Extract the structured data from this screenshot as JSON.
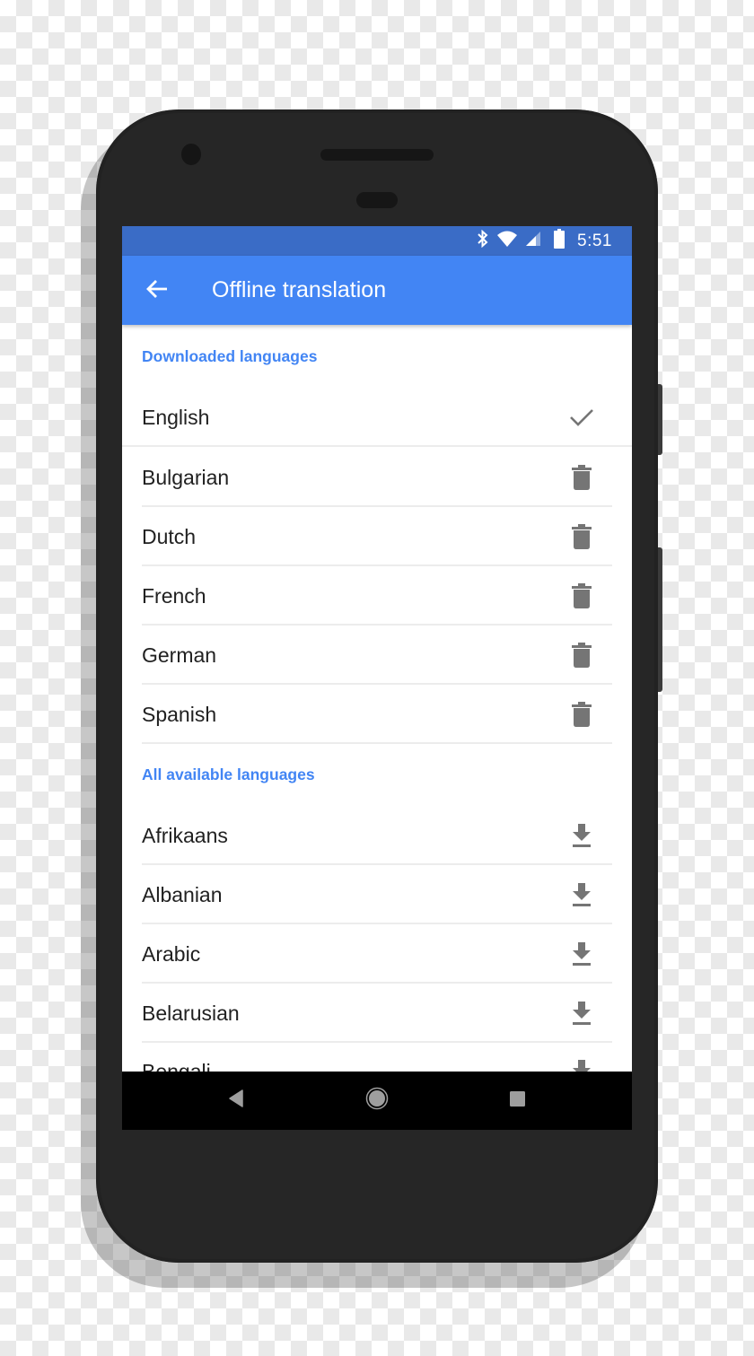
{
  "status_bar": {
    "icons": [
      "bluetooth-icon",
      "wifi-icon",
      "cellular-signal-icon",
      "battery-icon"
    ],
    "time": "5:51"
  },
  "app_bar": {
    "back_icon": "arrow-back-icon",
    "title": "Offline translation"
  },
  "sections": {
    "downloaded": {
      "header": "Downloaded languages",
      "items": [
        {
          "label": "English",
          "action_icon": "check-icon"
        },
        {
          "label": "Bulgarian",
          "action_icon": "delete-icon"
        },
        {
          "label": "Dutch",
          "action_icon": "delete-icon"
        },
        {
          "label": "French",
          "action_icon": "delete-icon"
        },
        {
          "label": "German",
          "action_icon": "delete-icon"
        },
        {
          "label": "Spanish",
          "action_icon": "delete-icon"
        }
      ]
    },
    "available": {
      "header": "All available languages",
      "items": [
        {
          "label": "Afrikaans",
          "action_icon": "download-icon"
        },
        {
          "label": "Albanian",
          "action_icon": "download-icon"
        },
        {
          "label": "Arabic",
          "action_icon": "download-icon"
        },
        {
          "label": "Belarusian",
          "action_icon": "download-icon"
        },
        {
          "label": "Bengali",
          "action_icon": "download-icon"
        }
      ]
    }
  },
  "nav_bar": {
    "buttons": [
      "back-triangle-icon",
      "home-circle-icon",
      "recents-square-icon"
    ]
  },
  "colors": {
    "status_bar": "#3a6cc6",
    "app_bar": "#4285f4",
    "section_header": "#4285f4",
    "icon_grey": "#757575",
    "phone_body": "#262626"
  }
}
